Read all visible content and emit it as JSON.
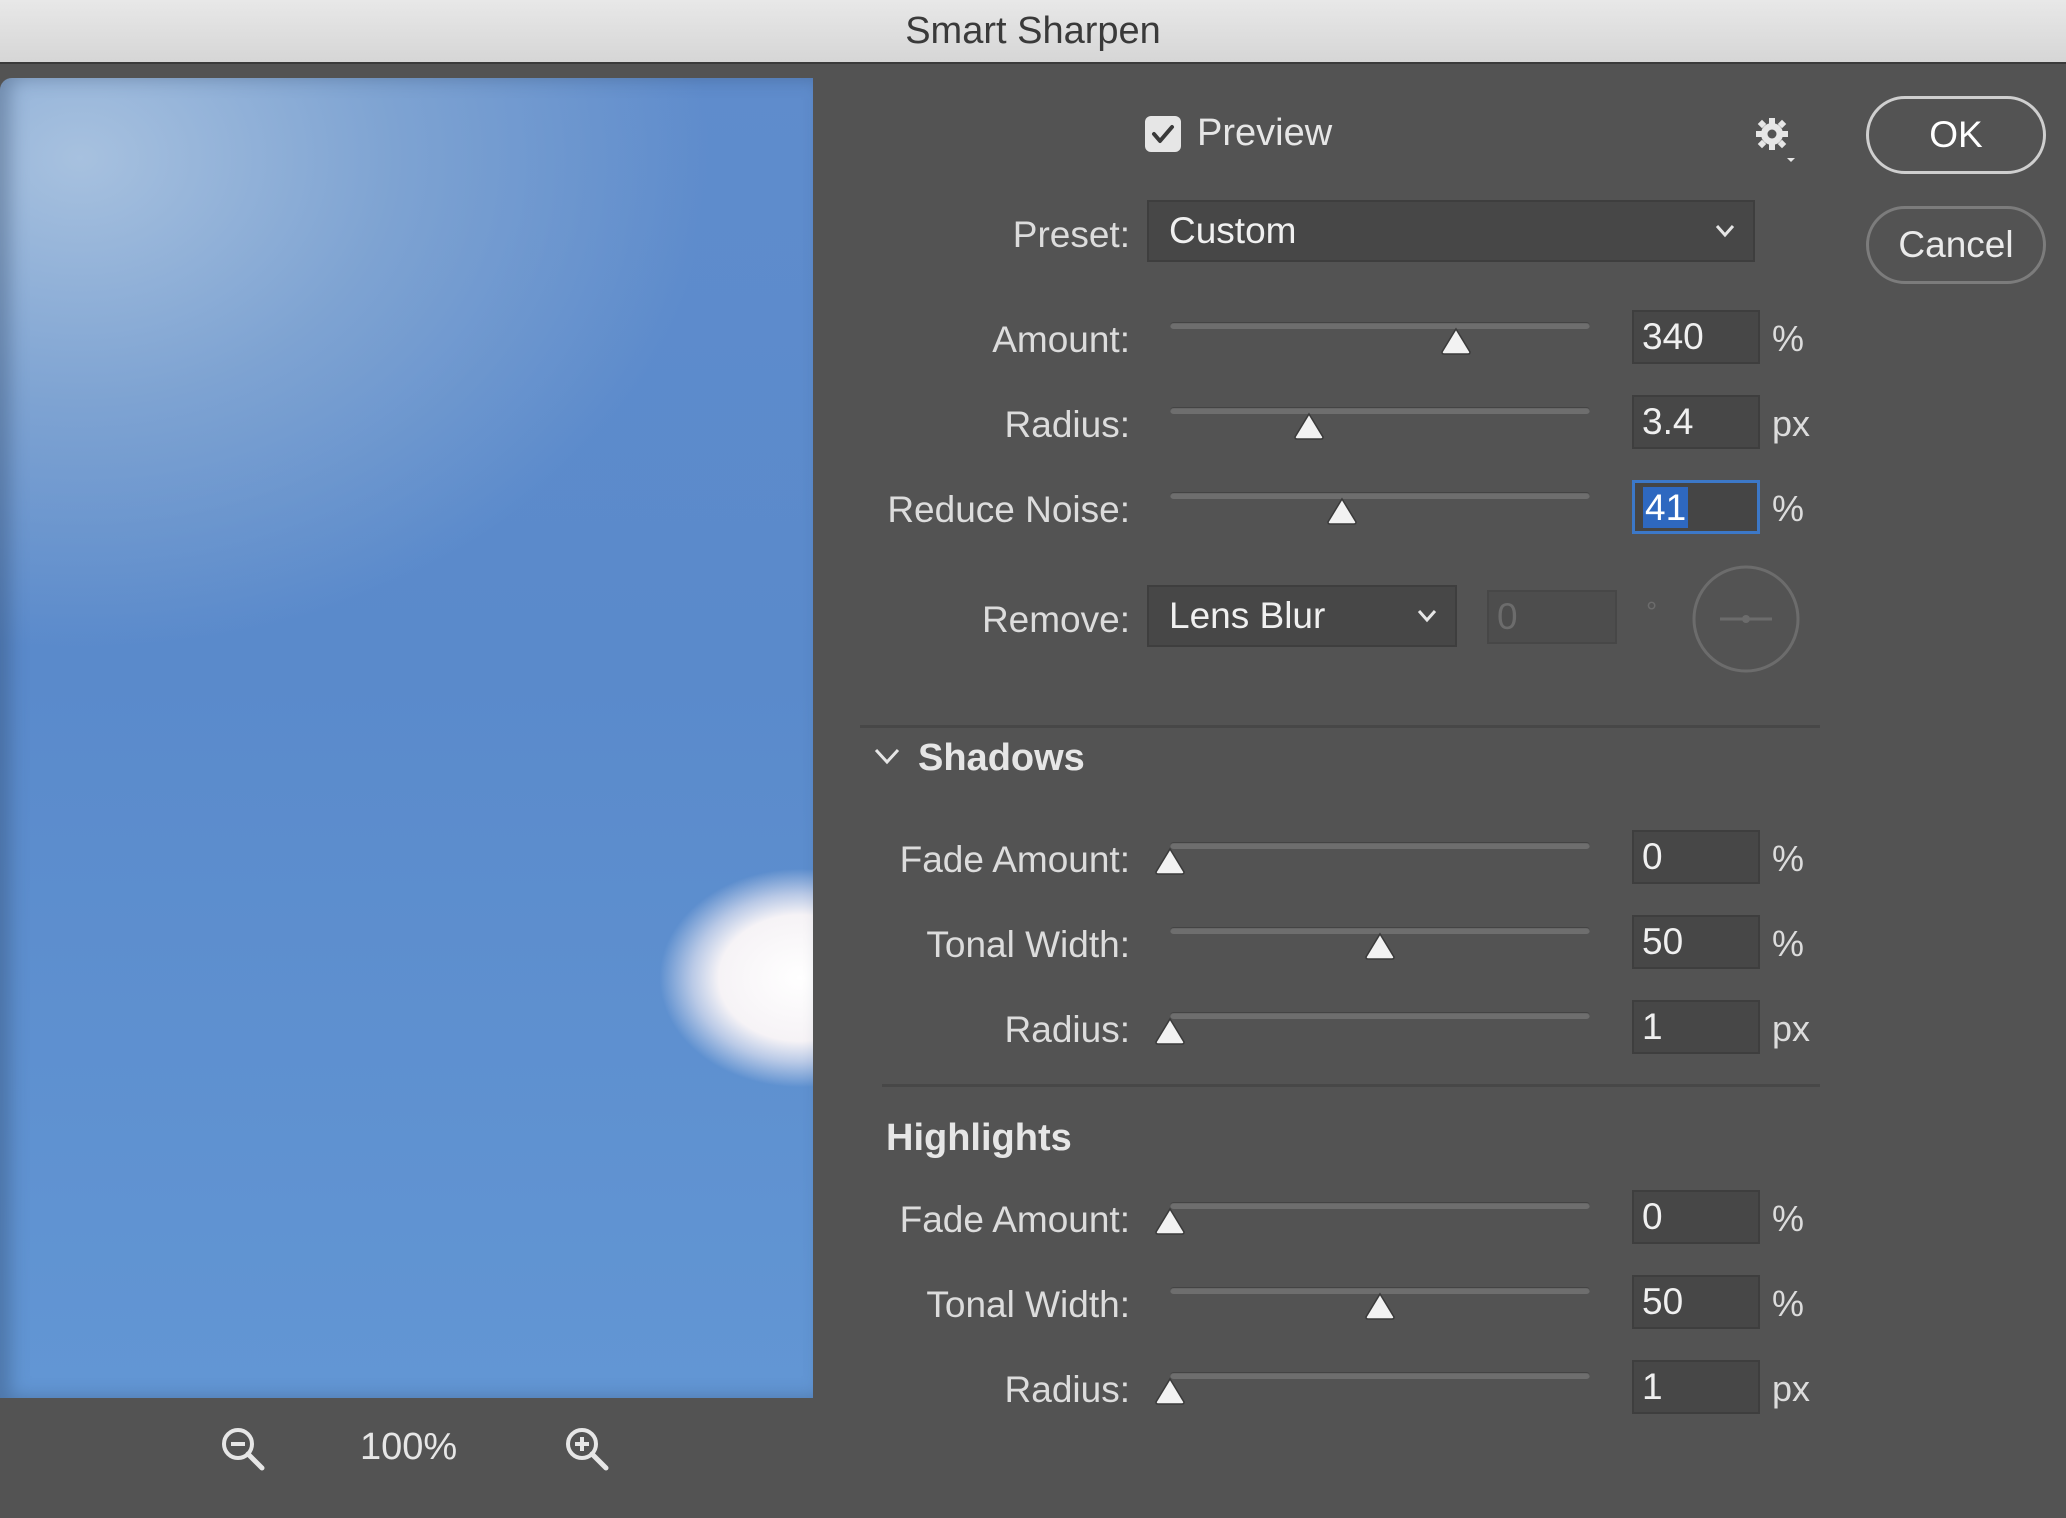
{
  "window": {
    "title": "Smart Sharpen"
  },
  "preview": {
    "label": "Preview",
    "checked": true
  },
  "zoom": {
    "level": "100%"
  },
  "buttons": {
    "ok": "OK",
    "cancel": "Cancel"
  },
  "preset": {
    "label": "Preset:",
    "value": "Custom"
  },
  "amount": {
    "label": "Amount:",
    "value": "340",
    "unit": "%",
    "slider_fraction": 0.68
  },
  "radius": {
    "label": "Radius:",
    "value": "3.4",
    "unit": "px",
    "slider_fraction": 0.33
  },
  "reduce_noise": {
    "label": "Reduce Noise:",
    "value": "41",
    "unit": "%",
    "slider_fraction": 0.41
  },
  "remove": {
    "label": "Remove:",
    "value": "Lens Blur",
    "angle_value": "0",
    "angle_unit": "°"
  },
  "shadows": {
    "title": "Shadows",
    "fade_amount": {
      "label": "Fade Amount:",
      "value": "0",
      "unit": "%",
      "slider_fraction": 0.0
    },
    "tonal_width": {
      "label": "Tonal Width:",
      "value": "50",
      "unit": "%",
      "slider_fraction": 0.5
    },
    "radius": {
      "label": "Radius:",
      "value": "1",
      "unit": "px",
      "slider_fraction": 0.0
    }
  },
  "highlights": {
    "title": "Highlights",
    "fade_amount": {
      "label": "Fade Amount:",
      "value": "0",
      "unit": "%",
      "slider_fraction": 0.0
    },
    "tonal_width": {
      "label": "Tonal Width:",
      "value": "50",
      "unit": "%",
      "slider_fraction": 0.5
    },
    "radius": {
      "label": "Radius:",
      "value": "1",
      "unit": "px",
      "slider_fraction": 0.0
    }
  },
  "colors": {
    "panel": "#535353",
    "accent": "#2e68c0",
    "field": "#474747"
  }
}
